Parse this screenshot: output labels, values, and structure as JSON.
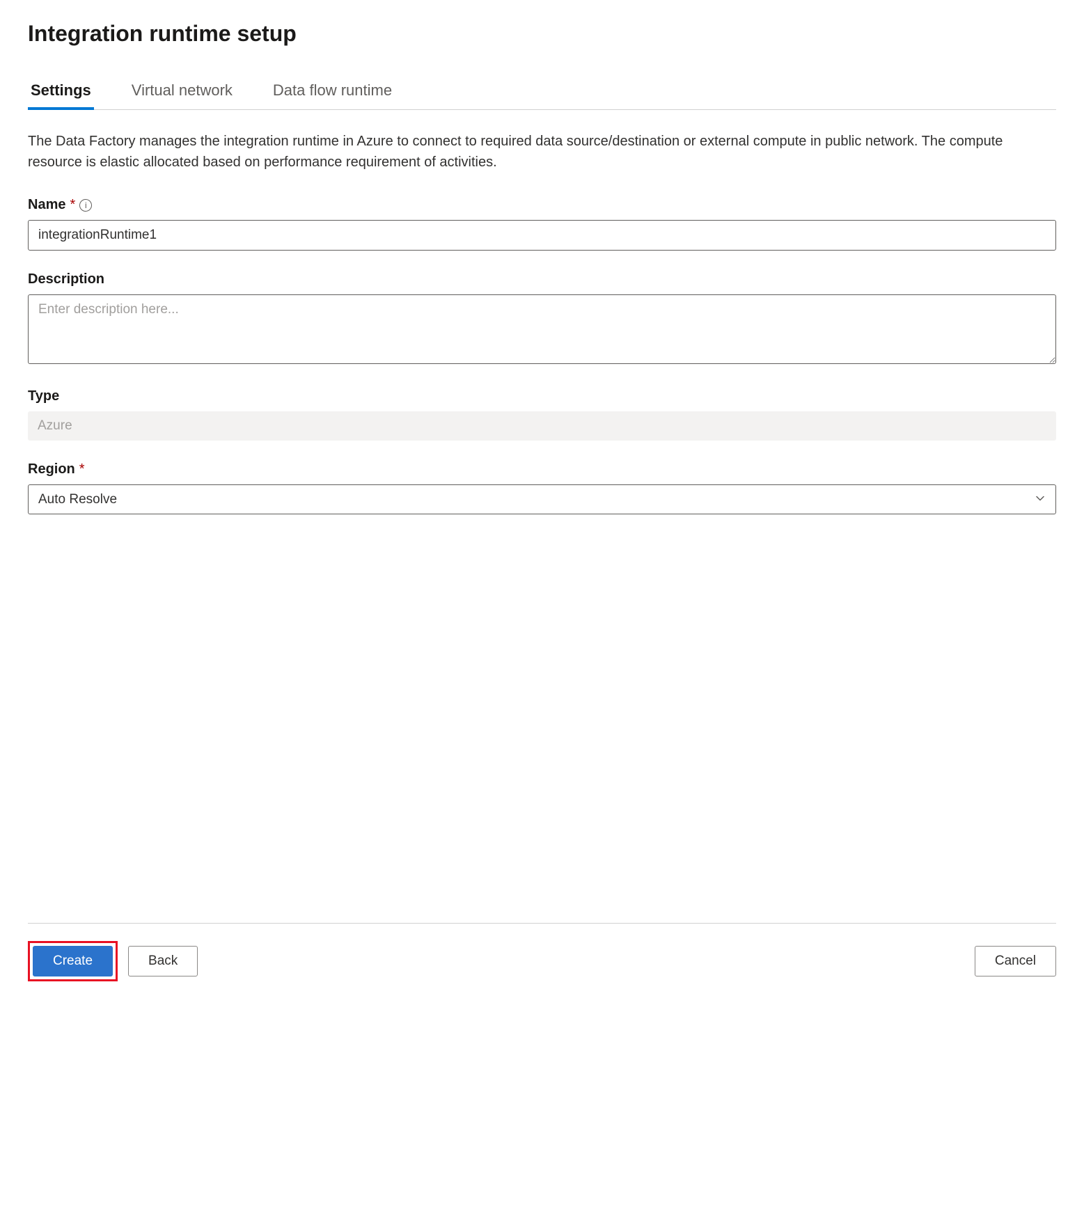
{
  "header": {
    "title": "Integration runtime setup"
  },
  "tabs": [
    {
      "label": "Settings",
      "active": true
    },
    {
      "label": "Virtual network",
      "active": false
    },
    {
      "label": "Data flow runtime",
      "active": false
    }
  ],
  "intro": "The Data Factory manages the integration runtime in Azure to connect to required data source/destination or external compute in public network. The compute resource is elastic allocated based on performance requirement of activities.",
  "fields": {
    "name": {
      "label": "Name",
      "required": true,
      "value": "integrationRuntime1",
      "hasInfo": true
    },
    "description": {
      "label": "Description",
      "required": false,
      "value": "",
      "placeholder": "Enter description here..."
    },
    "type": {
      "label": "Type",
      "required": false,
      "value": "Azure"
    },
    "region": {
      "label": "Region",
      "required": true,
      "value": "Auto Resolve"
    }
  },
  "footer": {
    "create": "Create",
    "back": "Back",
    "cancel": "Cancel"
  }
}
